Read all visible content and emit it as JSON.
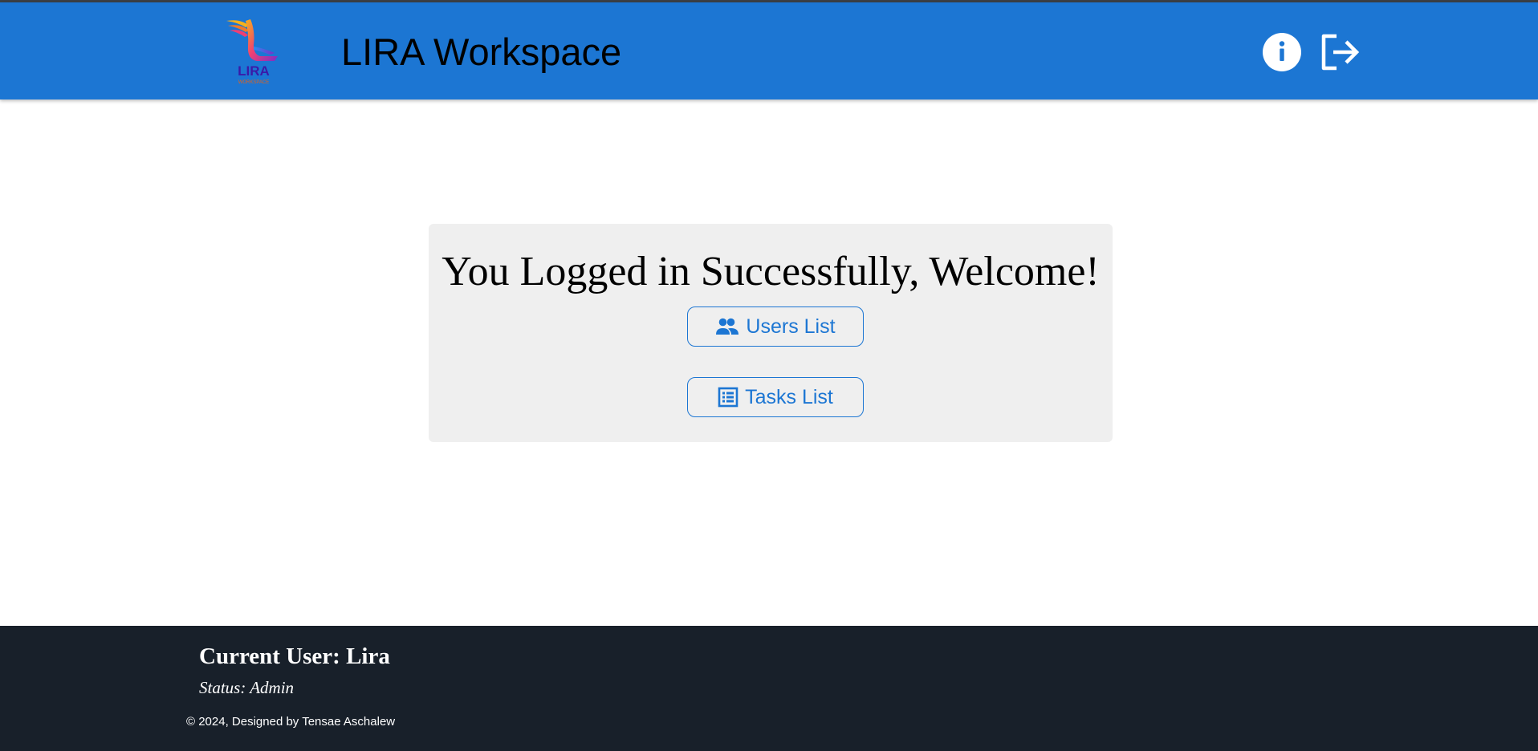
{
  "header": {
    "logo_text": "LIRA",
    "logo_subtext": "WORKSPACE",
    "title": "LIRA Workspace",
    "info_icon": "info-circle-icon",
    "logout_icon": "logout-icon"
  },
  "main": {
    "heading": "You Logged in Successfully, Welcome!",
    "buttons": [
      {
        "label": "Users List",
        "icon": "users-icon"
      },
      {
        "label": "Tasks List",
        "icon": "list-icon"
      }
    ]
  },
  "footer": {
    "current_user": "Current User: Lira",
    "status": "Status: Admin",
    "copyright": "© 2024, Designed by Tensae Aschalew"
  },
  "colors": {
    "header_bg": "#1c76d3",
    "accent": "#1c76d3",
    "card_bg": "#efefef",
    "footer_bg": "#18202a"
  }
}
